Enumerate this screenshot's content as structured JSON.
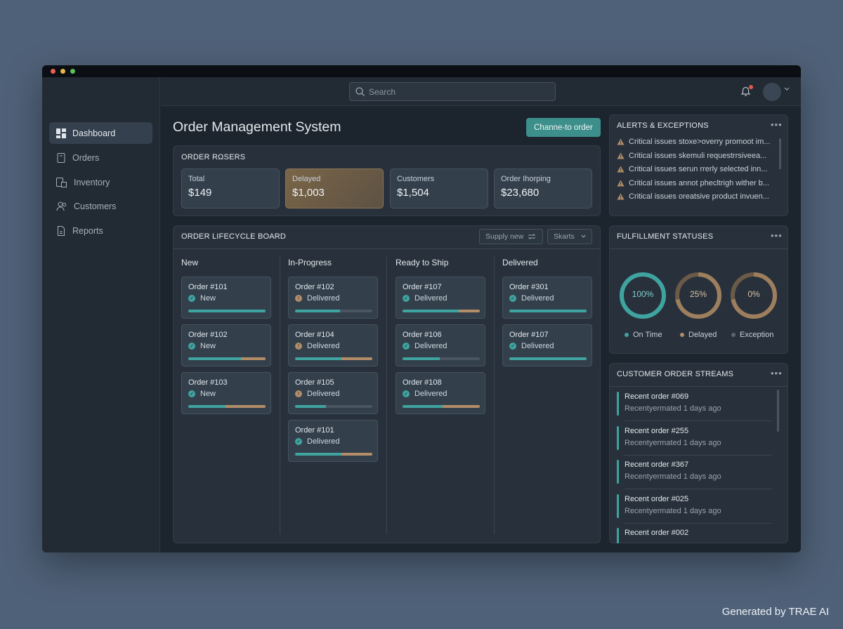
{
  "app": {
    "title": "Order Management System",
    "cta_label": "Channe-to order"
  },
  "window_controls": {
    "colors": [
      "#ec5f57",
      "#e1b84a",
      "#5bc05a"
    ]
  },
  "search": {
    "placeholder": "Search"
  },
  "sidebar": {
    "items": [
      {
        "label": "Dashboard",
        "icon": "dashboard-icon",
        "active": true
      },
      {
        "label": "Orders",
        "icon": "orders-icon",
        "active": false
      },
      {
        "label": "Inventory",
        "icon": "inventory-icon",
        "active": false
      },
      {
        "label": "Customers",
        "icon": "customers-icon",
        "active": false
      },
      {
        "label": "Reports",
        "icon": "reports-icon",
        "active": false
      }
    ]
  },
  "summary": {
    "title": "ORDER RΩSERS",
    "stats": [
      {
        "label": "Total",
        "value": "$149"
      },
      {
        "label": "Delayed",
        "value": "$1,003"
      },
      {
        "label": "Customers",
        "value": "$1,504"
      },
      {
        "label": "Order Ihorping",
        "value": "$23,680"
      }
    ]
  },
  "board": {
    "title": "ORDER LIFECYCLE BOARD",
    "filter_label": "Supply new",
    "sort_label": "Skarts",
    "columns": [
      {
        "name": "New",
        "cards": [
          {
            "id": "Order #101",
            "status": "New",
            "status_kind": "ok",
            "progress": 1.0,
            "late": 0.0
          },
          {
            "id": "Order #102",
            "status": "New",
            "status_kind": "ok",
            "progress": 0.68,
            "late": 0.32
          },
          {
            "id": "Order #103",
            "status": "New",
            "status_kind": "ok",
            "progress": 0.48,
            "late": 0.52
          }
        ]
      },
      {
        "name": "In-Progress",
        "cards": [
          {
            "id": "Order #102",
            "status": "Delivered",
            "status_kind": "warn",
            "progress": 0.58,
            "late": 0.0
          },
          {
            "id": "Order #104",
            "status": "Delivered",
            "status_kind": "warn",
            "progress": 0.6,
            "late": 0.4
          },
          {
            "id": "Order #105",
            "status": "Delivered",
            "status_kind": "warn",
            "progress": 0.4,
            "late": 0.0
          },
          {
            "id": "Order #101",
            "status": "Delivered",
            "status_kind": "ok",
            "progress": 0.6,
            "late": 0.4
          }
        ]
      },
      {
        "name": "Ready to Ship",
        "cards": [
          {
            "id": "Order #107",
            "status": "Delivered",
            "status_kind": "ok",
            "progress": 0.73,
            "late": 0.27
          },
          {
            "id": "Order #106",
            "status": "Delivered",
            "status_kind": "ok",
            "progress": 0.48,
            "late": 0.0
          },
          {
            "id": "Order #108",
            "status": "Delivered",
            "status_kind": "ok",
            "progress": 0.52,
            "late": 0.48
          }
        ]
      },
      {
        "name": "Delivered",
        "cards": [
          {
            "id": "Order #301",
            "status": "Delivered",
            "status_kind": "ok",
            "progress": 1.0,
            "late": 0.0
          },
          {
            "id": "Order #107",
            "status": "Delivered",
            "status_kind": "ok",
            "progress": 1.0,
            "late": 0.0
          }
        ]
      }
    ]
  },
  "alerts": {
    "title": "ALERTS & EXCEPTIONS",
    "items": [
      "Critical issues stoxe>overry promoot im...",
      "Critical issues skemuli requestrrsiveea...",
      "Critical issues serun rrerly selected inn...",
      "Critical issues annot phecltrigh wither b...",
      "Critical issues oreatsive product invuen..."
    ]
  },
  "fulfillment": {
    "title": "FULFILLMENT STATUSES",
    "rings": [
      {
        "label": "On Time",
        "value": "100%",
        "fraction": 1.0,
        "color": "#3fa3a0"
      },
      {
        "label": "Delayed",
        "value": "25%",
        "fraction": 0.25,
        "color": "#b28d68"
      },
      {
        "label": "Exception",
        "value": "0%",
        "fraction": 0.0,
        "color": "#b28d68"
      }
    ]
  },
  "streams": {
    "title": "CUSTOMER ORDER STREAMS",
    "items": [
      {
        "title": "Recent order #069",
        "subtitle": "Recentyermated 1 days ago"
      },
      {
        "title": "Recent order #255",
        "subtitle": "Recentyermated 1 days ago"
      },
      {
        "title": "Recent order #367",
        "subtitle": "Recentyermated 1 days ago"
      },
      {
        "title": "Recent order #025",
        "subtitle": "Recentyermated 1 days ago"
      },
      {
        "title": "Recent order #002",
        "subtitle": ""
      }
    ]
  },
  "watermark": "Generated by TRAE AI"
}
